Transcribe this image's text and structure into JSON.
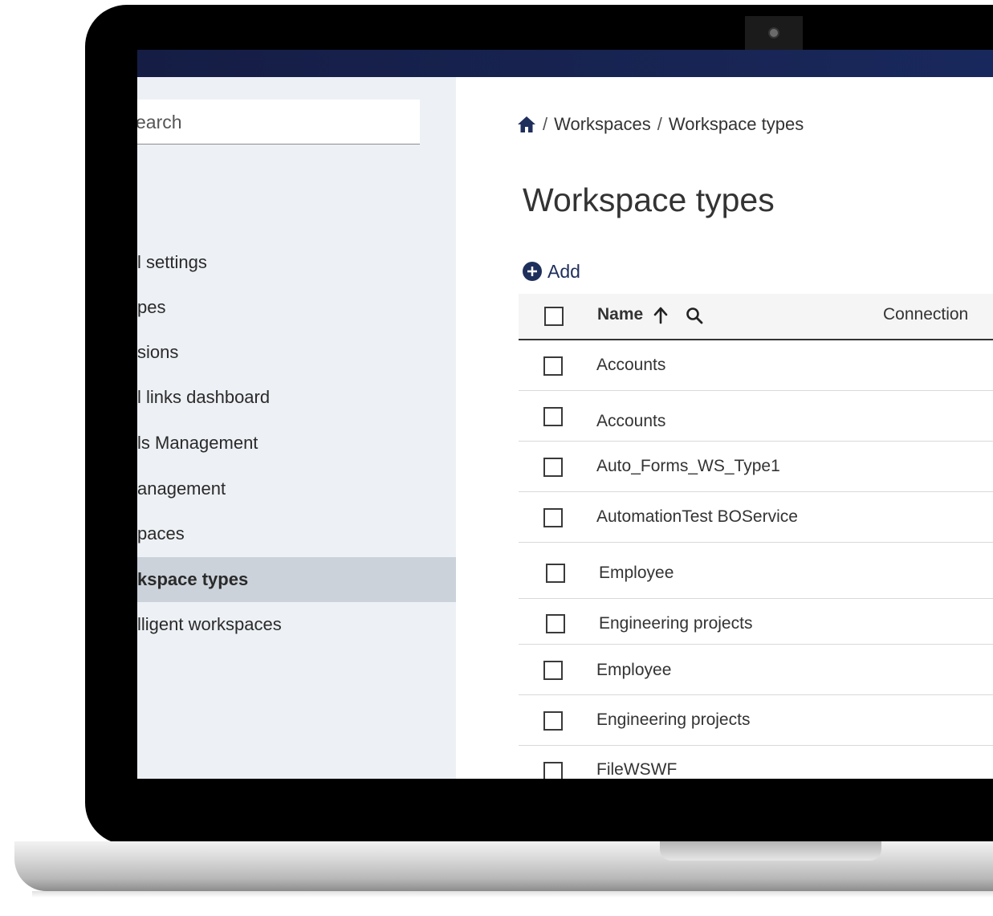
{
  "sidebar": {
    "search_placeholder": "earch",
    "items": [
      {
        "label": "l settings"
      },
      {
        "label": "pes"
      },
      {
        "label": "sions"
      },
      {
        "label": "l links dashboard"
      },
      {
        "label": "ls Management"
      },
      {
        "label": "anagement"
      },
      {
        "label": "paces"
      },
      {
        "label": "kspace types"
      },
      {
        "label": "lligent workspaces"
      }
    ]
  },
  "breadcrumb": {
    "home_icon": "home-icon",
    "items": [
      "Workspaces",
      "Workspace types"
    ],
    "separator": "/"
  },
  "page": {
    "title": "Workspace types",
    "add_label": "Add"
  },
  "table": {
    "columns": {
      "name": "Name",
      "connection": "Connection"
    },
    "sort": "ascending",
    "rows": [
      {
        "name": "Accounts"
      },
      {
        "name": "Accounts"
      },
      {
        "name": "Auto_Forms_WS_Type1"
      },
      {
        "name": "AutomationTest BOService"
      },
      {
        "name": "Employee"
      },
      {
        "name": "Engineering projects"
      },
      {
        "name": "Employee"
      },
      {
        "name": "Engineering projects"
      },
      {
        "name": "FileWSWF"
      }
    ]
  },
  "colors": {
    "topbar": "#19285c",
    "sidebar_bg": "#edf0f4",
    "selected_bg": "#cbd2da",
    "accent": "#1f2f5c"
  }
}
